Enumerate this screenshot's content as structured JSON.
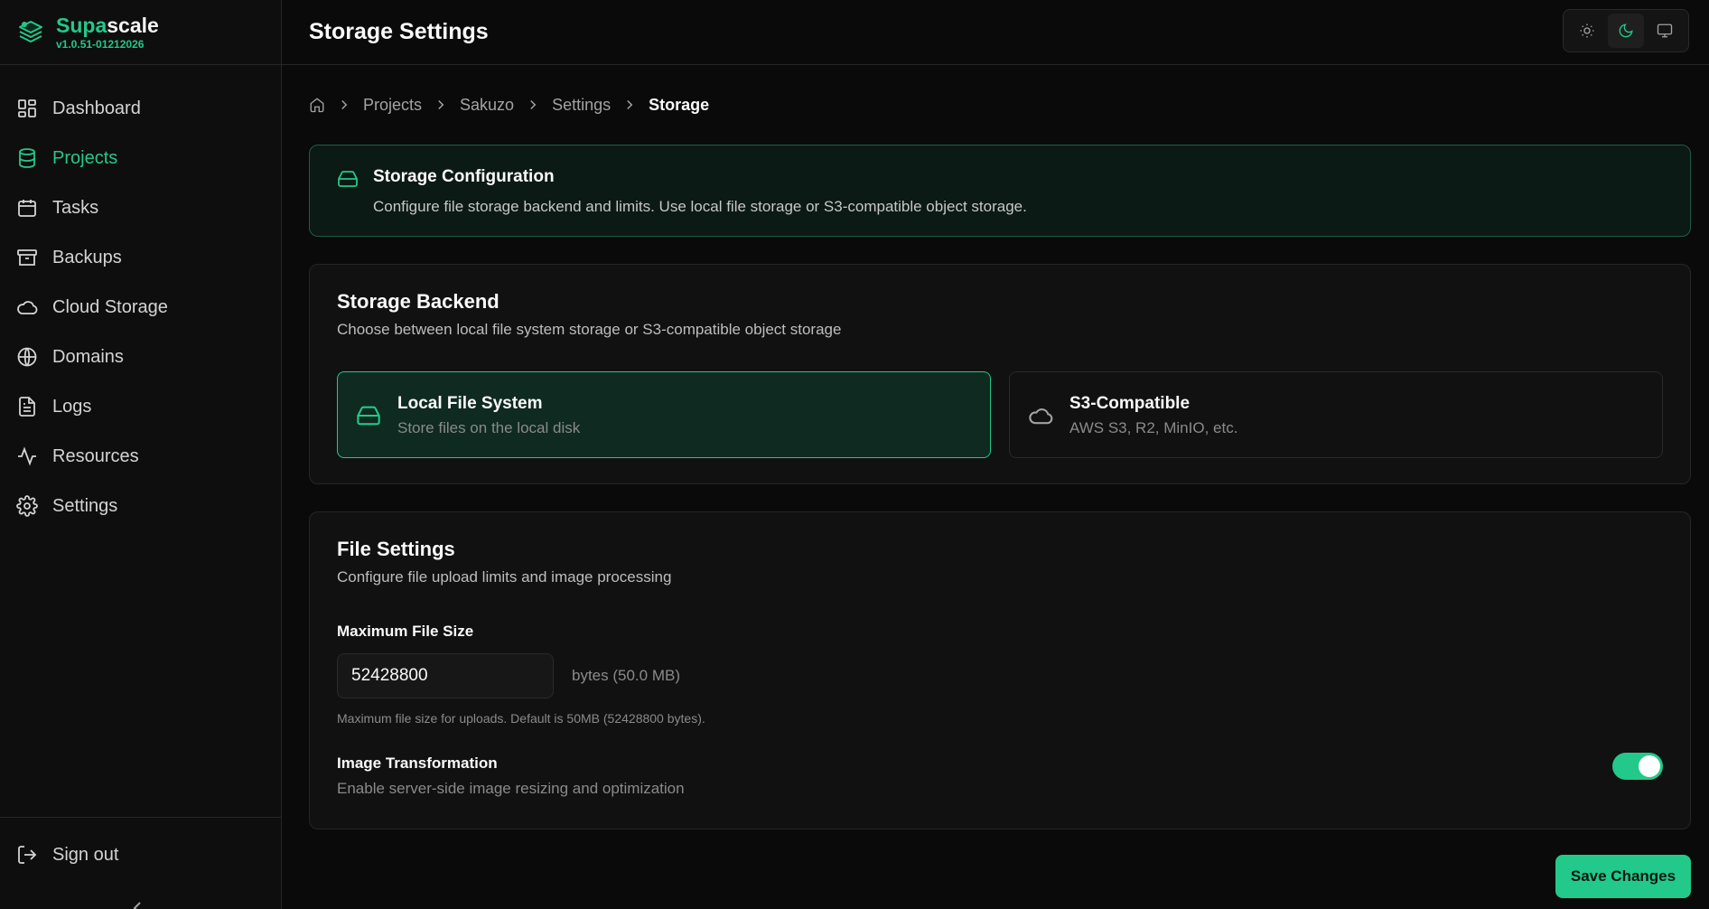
{
  "brand": {
    "name_accent": "Supa",
    "name_rest": "scale",
    "version": "v1.0.51-01212026",
    "accent_color": "#22c98a"
  },
  "sidebar": {
    "items": [
      {
        "label": "Dashboard",
        "icon": "dashboard-grid-icon",
        "active": false
      },
      {
        "label": "Projects",
        "icon": "database-icon",
        "active": true
      },
      {
        "label": "Tasks",
        "icon": "calendar-icon",
        "active": false
      },
      {
        "label": "Backups",
        "icon": "archive-icon",
        "active": false
      },
      {
        "label": "Cloud Storage",
        "icon": "cloud-icon",
        "active": false
      },
      {
        "label": "Domains",
        "icon": "globe-icon",
        "active": false
      },
      {
        "label": "Logs",
        "icon": "file-text-icon",
        "active": false
      },
      {
        "label": "Resources",
        "icon": "activity-icon",
        "active": false
      },
      {
        "label": "Settings",
        "icon": "gear-icon",
        "active": false
      }
    ],
    "signout_label": "Sign out"
  },
  "header": {
    "title": "Storage Settings",
    "theme_modes": [
      "sun-icon",
      "moon-icon",
      "monitor-icon"
    ],
    "active_theme": "moon-icon"
  },
  "breadcrumb": {
    "items": [
      "Projects",
      "Sakuzo",
      "Settings"
    ],
    "current": "Storage"
  },
  "info": {
    "title": "Storage Configuration",
    "description": "Configure file storage backend and limits. Use local file storage or S3-compatible object storage."
  },
  "backend": {
    "title": "Storage Backend",
    "description": "Choose between local file system storage or S3-compatible object storage",
    "options": [
      {
        "title": "Local File System",
        "subtitle": "Store files on the local disk",
        "selected": true
      },
      {
        "title": "S3-Compatible",
        "subtitle": "AWS S3, R2, MinIO, etc.",
        "selected": false
      }
    ]
  },
  "file_settings": {
    "title": "File Settings",
    "description": "Configure file upload limits and image processing",
    "max_size_label": "Maximum File Size",
    "max_size_value": "52428800",
    "max_size_unit": "bytes (50.0 MB)",
    "max_size_hint": "Maximum file size for uploads. Default is 50MB (52428800 bytes).",
    "image_transform_label": "Image Transformation",
    "image_transform_desc": "Enable server-side image resizing and optimization",
    "image_transform_enabled": true
  },
  "actions": {
    "save_label": "Save Changes"
  }
}
